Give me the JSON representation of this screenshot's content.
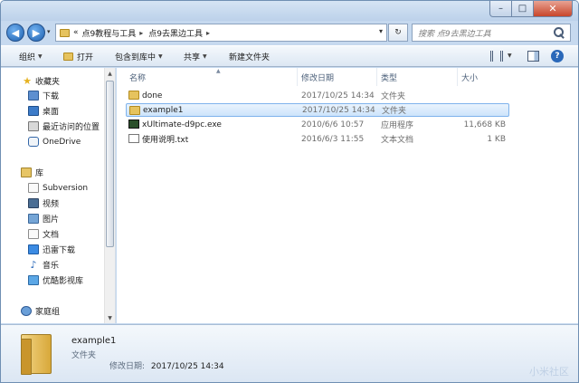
{
  "window": {
    "title_buttons": {
      "minimize": "–",
      "maximize": "□",
      "close": "✕"
    }
  },
  "navigation": {
    "back_icon": "◀",
    "forward_icon": "▶",
    "dropdown_icon": "▾",
    "breadcrumb": [
      "«",
      "点9教程与工具",
      "点9去黑边工具"
    ],
    "separator": "▸",
    "refresh_icon": "↻"
  },
  "search": {
    "placeholder": "搜索 点9去黑边工具"
  },
  "toolbar": {
    "organize": "组织",
    "open": "打开",
    "include_in_library": "包含到库中",
    "share": "共享",
    "new_folder": "新建文件夹",
    "help": "?"
  },
  "sidebar": {
    "favorites_header": "收藏夹",
    "favorites": [
      {
        "label": "下载",
        "icon": "download-folder"
      },
      {
        "label": "桌面",
        "icon": "desktop"
      },
      {
        "label": "最近访问的位置",
        "icon": "recent-places"
      },
      {
        "label": "OneDrive",
        "icon": "onedrive"
      }
    ],
    "libraries_header": "库",
    "libraries": [
      {
        "label": "Subversion",
        "icon": "subversion"
      },
      {
        "label": "视频",
        "icon": "video"
      },
      {
        "label": "图片",
        "icon": "pictures"
      },
      {
        "label": "文档",
        "icon": "documents"
      },
      {
        "label": "迅雷下载",
        "icon": "xunlei"
      },
      {
        "label": "音乐",
        "icon": "music"
      },
      {
        "label": "优酷影视库",
        "icon": "youku"
      }
    ],
    "homegroup": "家庭组"
  },
  "columns": {
    "name": "名称",
    "date": "修改日期",
    "type": "类型",
    "size": "大小"
  },
  "files": [
    {
      "name": "done",
      "date": "2017/10/25 14:34",
      "type": "文件夹",
      "size": "",
      "icon": "folder",
      "selected": false
    },
    {
      "name": "example1",
      "date": "2017/10/25 14:34",
      "type": "文件夹",
      "size": "",
      "icon": "folder",
      "selected": true
    },
    {
      "name": "xUltimate-d9pc.exe",
      "date": "2010/6/6 10:57",
      "type": "应用程序",
      "size": "11,668 KB",
      "icon": "exe",
      "selected": false
    },
    {
      "name": "使用说明.txt",
      "date": "2016/6/3 11:55",
      "type": "文本文档",
      "size": "1 KB",
      "icon": "txt",
      "selected": false
    }
  ],
  "details_pane": {
    "name": "example1",
    "type": "文件夹",
    "date_label": "修改日期:",
    "date_value": "2017/10/25 14:34"
  },
  "watermark": "小米社区"
}
